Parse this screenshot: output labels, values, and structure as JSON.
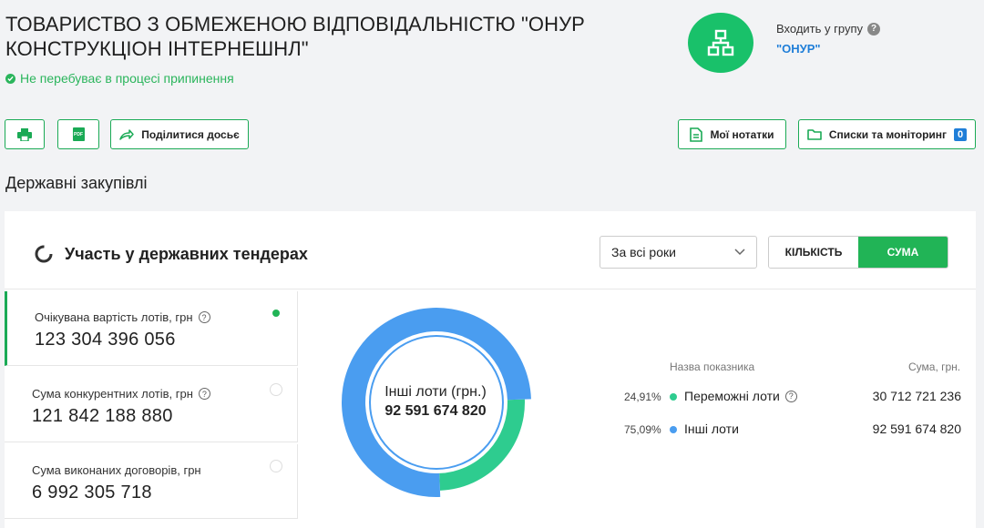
{
  "company": {
    "name": "ТОВАРИСТВО З ОБМЕЖЕНОЮ ВІДПОВІДАЛЬНІСТЮ \"ОНУР КОНСТРУКЦІОН ІНТЕРНЕШНЛ\"",
    "status": "Не перебуває в процесі припинення"
  },
  "group": {
    "label": "Входить у групу",
    "name": "\"ОНУР\""
  },
  "toolbar": {
    "print_icon": "printer-icon",
    "pdf_label": "PDF",
    "share_label": "Поділитися досьє",
    "notes_label": "Мої нотатки",
    "lists_label": "Списки та моніторинг",
    "lists_count": "0"
  },
  "section_title": "Державні закупівлі",
  "card": {
    "title": "Участь у державних тендерах",
    "period": "За всі роки",
    "toggle_count": "КІЛЬКІСТЬ",
    "toggle_sum": "СУМА"
  },
  "metrics": [
    {
      "label": "Очікувана вартість лотів, грн",
      "value": "123 304 396 056",
      "selected": true,
      "help": true
    },
    {
      "label": "Сума конкурентних лотів, грн",
      "value": "121 842 188 880",
      "selected": false,
      "help": true
    },
    {
      "label": "Сума виконаних договорів, грн",
      "value": "6 992 305 718",
      "selected": false,
      "help": false
    }
  ],
  "donut": {
    "center_label": "Інші лоти (грн.)",
    "center_value": "92 591 674 820"
  },
  "legend": {
    "col_name": "Назва показника",
    "col_sum": "Сума, грн.",
    "rows": [
      {
        "pct": "24,91%",
        "name": "Переможні лоти",
        "sum": "30 712 721 236",
        "color": "#2ecc8f",
        "share": 0.2491
      },
      {
        "pct": "75,09%",
        "name": "Інші лоти",
        "sum": "92 591 674 820",
        "color": "#4a9df0",
        "share": 0.7509
      }
    ]
  }
}
